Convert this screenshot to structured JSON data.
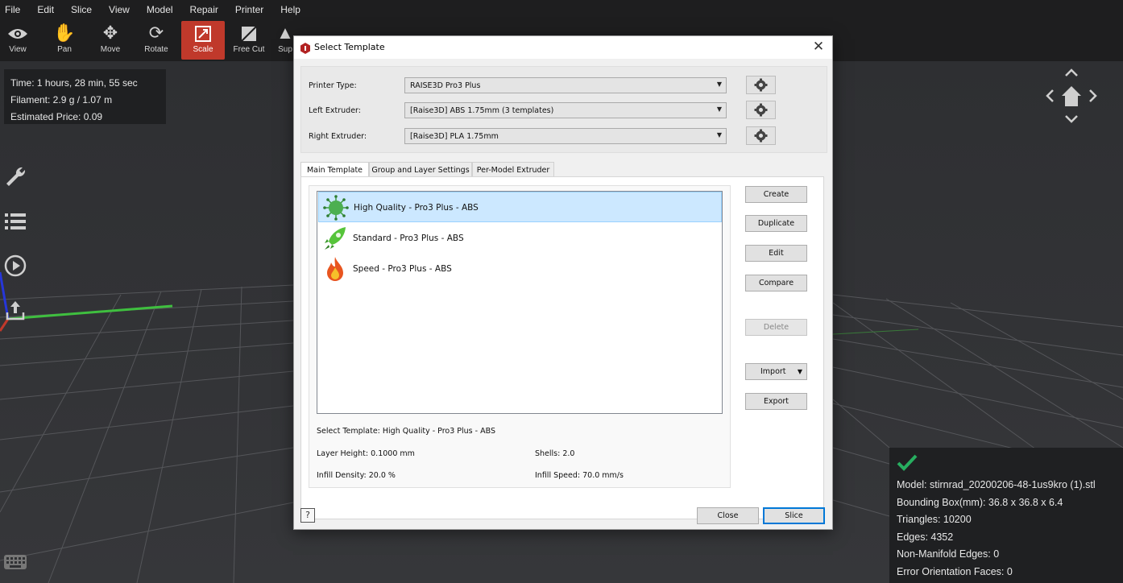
{
  "menu": [
    "File",
    "Edit",
    "Slice",
    "View",
    "Model",
    "Repair",
    "Printer",
    "Help"
  ],
  "toolbar": {
    "tools": [
      {
        "label": "View",
        "icon": "eye-icon"
      },
      {
        "label": "Pan",
        "icon": "hand-icon"
      },
      {
        "label": "Move",
        "icon": "move-arrows-icon"
      },
      {
        "label": "Rotate",
        "icon": "rotate-icon"
      },
      {
        "label": "Scale",
        "icon": "scale-icon",
        "active": true
      },
      {
        "label": "Free Cut",
        "icon": "free-cut-icon"
      },
      {
        "label": "Sup",
        "icon": "support-icon"
      }
    ]
  },
  "stats": {
    "time": "Time: 1 hours, 28 min, 55 sec",
    "filament": "Filament: 2.9 g / 1.07 m",
    "price": "Estimated Price: 0.09"
  },
  "model_info": {
    "model": "Model: stirnrad_20200206-48-1us9kro (1).stl",
    "bbox": "Bounding Box(mm): 36.8 x 36.8 x 6.4",
    "triangles": "Triangles: 10200",
    "edges": "Edges: 4352",
    "non_manifold": "Non-Manifold Edges: 0",
    "error_orientation": "Error Orientation Faces: 0",
    "status_icon": "checkmark-icon",
    "status_color": "#27ae60"
  },
  "dialog": {
    "title": "Select Template",
    "printer_type_label": "Printer Type:",
    "printer_type_value": "RAISE3D Pro3 Plus",
    "left_extruder_label": "Left Extruder:",
    "left_extruder_value": "[Raise3D] ABS 1.75mm (3 templates)",
    "right_extruder_label": "Right Extruder:",
    "right_extruder_value": "[Raise3D] PLA 1.75mm",
    "tabs": [
      "Main Template",
      "Group and Layer Settings",
      "Per-Model Extruder"
    ],
    "templates": [
      {
        "name": "High Quality - Pro3 Plus - ABS",
        "icon": "high-quality-virus-icon",
        "selected": true
      },
      {
        "name": "Standard - Pro3 Plus - ABS",
        "icon": "standard-rocket-icon"
      },
      {
        "name": "Speed - Pro3 Plus - ABS",
        "icon": "speed-flame-icon"
      }
    ],
    "selected_template": "Select Template: High Quality - Pro3 Plus - ABS",
    "layer_height": "Layer Height: 0.1000 mm",
    "shells": "Shells: 2.0",
    "infill_density": "Infill Density: 20.0 %",
    "infill_speed": "Infill Speed: 70.0 mm/s",
    "buttons": {
      "create": "Create",
      "duplicate": "Duplicate",
      "edit": "Edit",
      "compare": "Compare",
      "delete": "Delete",
      "import": "Import",
      "export": "Export",
      "close": "Close",
      "slice": "Slice"
    },
    "help": "?"
  },
  "colors": {
    "accent": "#c0392b",
    "selection": "#cce8ff",
    "default_button_border": "#0078d7"
  }
}
